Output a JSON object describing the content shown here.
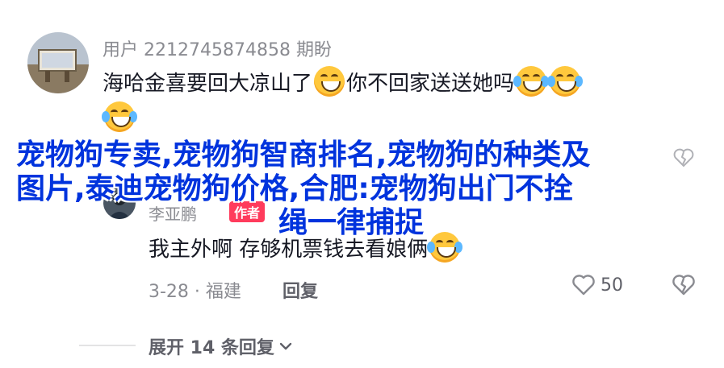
{
  "top_comment": {
    "username": "用户 2212745874858 期盼",
    "text_part1": "海哈金喜要回大凉山了",
    "text_part2": "你不回家送送她吗"
  },
  "overlay_headline": {
    "line1": "宠物狗专卖,宠物狗智商排名,宠物狗的种类及",
    "line2": "图片,泰迪宠物狗价格,合肥:宠物狗出门不拴",
    "line3": "绳一律捕捉"
  },
  "reply": {
    "username": "李亚鹏",
    "badge": "作者",
    "text": "我主外啊 存够机票钱去看娘俩",
    "date_location": "3-28 · 福建",
    "reply_label": "回复",
    "like_count": "50"
  },
  "expand": {
    "label": "展开 14 条回复"
  },
  "icons": {
    "like": "heart-outline-icon",
    "dislike": "broken-heart-icon",
    "chevron": "chevron-down-icon",
    "emoji_grin": "grinning-face-icon",
    "emoji_tears": "tears-of-joy-icon"
  },
  "colors": {
    "text": "#161823",
    "muted": "#8a8b91",
    "headline": "#0033dd",
    "badge": "#ff3b5c"
  }
}
